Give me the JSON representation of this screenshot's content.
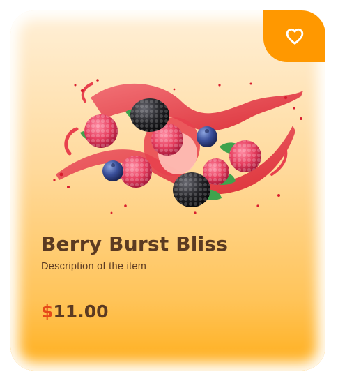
{
  "product": {
    "title": "Berry Burst Bliss",
    "description": "Description of the item",
    "currency_symbol": "$",
    "price": "11.00",
    "image_icon": "berry-splash-image"
  },
  "favorite": {
    "icon": "heart-outline-icon"
  },
  "colors": {
    "accent": "#ff9800",
    "price_symbol": "#e64a19",
    "text": "#5b3a22"
  }
}
